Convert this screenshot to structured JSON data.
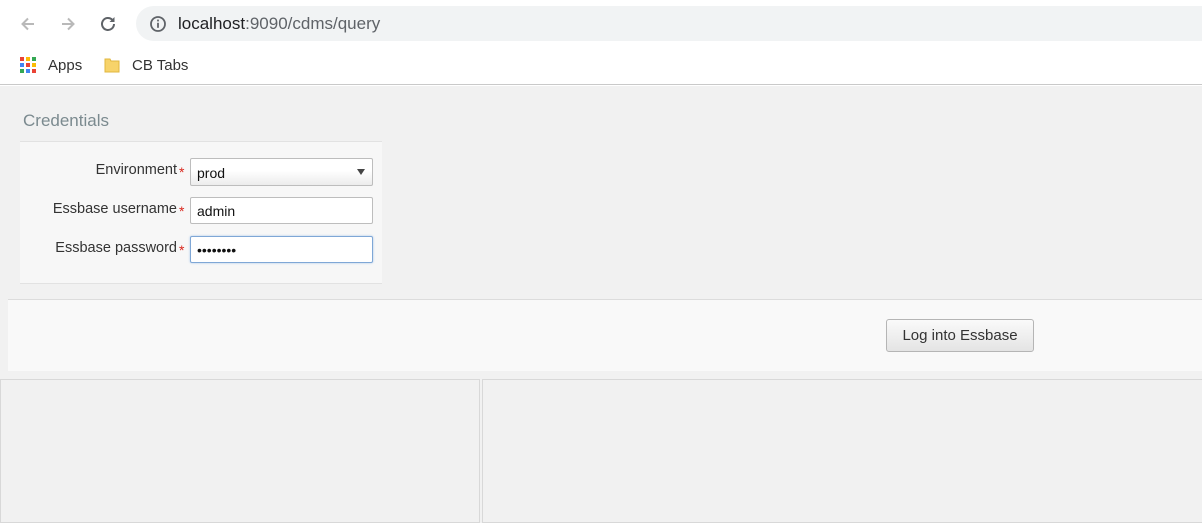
{
  "browser": {
    "url_host": "localhost",
    "url_rest": ":9090/cdms/query",
    "bookmarks": [
      {
        "label": "Apps",
        "icon": "apps-grid-icon"
      },
      {
        "label": "CB Tabs",
        "icon": "folder-icon"
      }
    ]
  },
  "credentials": {
    "title": "Credentials",
    "environment_label": "Environment",
    "environment_value": "prod",
    "username_label": "Essbase username",
    "username_value": "admin",
    "password_label": "Essbase password",
    "password_value": "••••••••",
    "required_marker": "*"
  },
  "actions": {
    "login_label": "Log into Essbase"
  },
  "colors": {
    "required": "#d9261c",
    "focus_border": "#7fa7d6",
    "page_bg": "#f1f1f1"
  }
}
